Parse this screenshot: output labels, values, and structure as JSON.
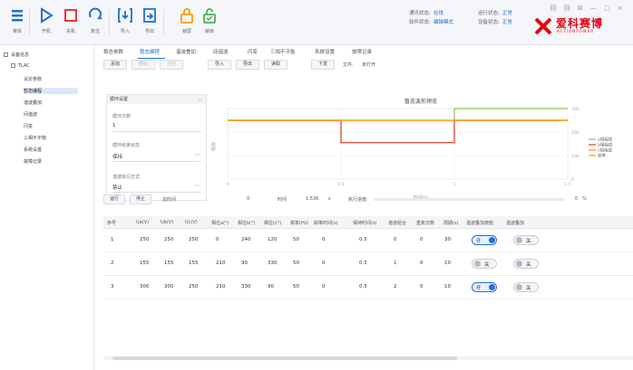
{
  "toolbar": {
    "buttons": [
      {
        "label": "菜单",
        "icon": "menu-icon"
      },
      {
        "label": "开机",
        "icon": "play-icon"
      },
      {
        "label": "关机",
        "icon": "stop-icon"
      },
      {
        "label": "复位",
        "icon": "reset-icon"
      },
      {
        "label": "导入",
        "icon": "import-icon"
      },
      {
        "label": "导出",
        "icon": "export-icon"
      },
      {
        "label": "锁屏",
        "icon": "lock-icon"
      },
      {
        "label": "解锁",
        "icon": "unlock-icon"
      }
    ],
    "status": {
      "comm_label": "通讯状态:",
      "comm_value": "在线",
      "run_label": "运行状态:",
      "run_value": "正常",
      "mode_label": "软件状态:",
      "mode_value": "编辑模式",
      "dev_label": "设备状态:",
      "dev_value": "正常"
    },
    "window_controls": "回 回 ⊠ — □ ×",
    "brand": {
      "name": "爱科赛博",
      "tagline": "ACTIONPOWER"
    }
  },
  "tree": {
    "root": "设备信息",
    "device": "TLAC",
    "items": [
      "设定参数",
      "暂态编程",
      "谐波叠加",
      "间谐波",
      "闪变",
      "三相不平衡",
      "系统设置",
      "故障记录"
    ],
    "selected_index": 1
  },
  "tabs": [
    "稳态参数",
    "暂态编程",
    "谐波叠加",
    "间谐波",
    "闪变",
    "三相不平衡",
    "系统设置",
    "故障记录"
  ],
  "active_tab": 1,
  "actions": {
    "buttons": [
      "添加",
      "删除",
      "清空",
      "导入",
      "导出",
      "读取",
      "下发"
    ],
    "disabled": [
      false,
      true,
      true,
      false,
      false,
      false,
      false
    ],
    "file_label": "文件:",
    "file_value": "未打开"
  },
  "params": {
    "header": "循环设置",
    "fields": [
      {
        "label": "循环次数",
        "value": "1",
        "dropdown": false
      },
      {
        "label": "循环结束状态",
        "value": "保持",
        "dropdown": true
      },
      {
        "label": "谐波执行方式",
        "value": "禁止",
        "dropdown": true
      }
    ]
  },
  "run": {
    "start_label": "运行",
    "stop_label": "停止",
    "total_time_label": "总时间",
    "total_time_value": "0",
    "time_label": "时间",
    "time_value": "1.536",
    "time_unit": "s",
    "progress_label": "执行进度:",
    "progress_percent": "0",
    "percent_unit": "%"
  },
  "table": {
    "columns": [
      "序号",
      "Ua(V)",
      "Ub(V)",
      "Uc(V)",
      "相位a(°)",
      "相位b(°)",
      "相位c(°)",
      "频率(Hz)",
      "斜率时间(s)",
      "保持时间(s)",
      "谐波组合",
      "重复次数",
      "周期(s)",
      "谐波叠加使能",
      "谐波叠加"
    ],
    "rows": [
      {
        "cells": [
          "1",
          "250",
          "250",
          "250",
          "0",
          "240",
          "120",
          "50",
          "0",
          "0.5",
          "0",
          "0",
          "30"
        ],
        "enable": "开",
        "enable_on": true,
        "overlay": "关",
        "overlay_on": false
      },
      {
        "cells": [
          "2",
          "155",
          "155",
          "155",
          "210",
          "90",
          "330",
          "50",
          "0",
          "0.5",
          "1",
          "0",
          "10"
        ],
        "enable": "关",
        "enable_on": false,
        "overlay": "关",
        "overlay_on": false
      },
      {
        "cells": [
          "3",
          "300",
          "300",
          "250",
          "210",
          "330",
          "90",
          "50",
          "0",
          "0.5",
          "2",
          "0",
          "10"
        ],
        "enable": "开",
        "enable_on": true,
        "overlay": "关",
        "overlay_on": false
      }
    ]
  },
  "chart_data": {
    "type": "line",
    "title": "暂态波形预览",
    "xlabel": "时间(s)",
    "ylabel": "幅值",
    "xlim": [
      0,
      1.5
    ],
    "ylim": [
      0,
      300
    ],
    "yticks": [
      0,
      100,
      200,
      300
    ],
    "xticks": [
      0,
      0.5,
      1.0,
      1.5
    ],
    "series": [
      {
        "name": "a相幅值",
        "color": "#8bc34a",
        "x": [
          0,
          0.5,
          0.5,
          1.0,
          1.0,
          1.5
        ],
        "y": [
          250,
          250,
          155,
          155,
          300,
          300
        ]
      },
      {
        "name": "b相幅值",
        "color": "#e53935",
        "x": [
          0,
          0.5,
          0.5,
          1.0,
          1.0,
          1.5
        ],
        "y": [
          250,
          250,
          155,
          155,
          250,
          250
        ]
      },
      {
        "name": "c相幅值",
        "color": "#ff9800",
        "x": [
          0,
          1.5
        ],
        "y": [
          250,
          250
        ]
      },
      {
        "name": "频率",
        "color": "#ff9800",
        "x": [
          0,
          1.5
        ],
        "y": [
          250,
          250
        ]
      }
    ],
    "legend": "right",
    "grid": true
  }
}
